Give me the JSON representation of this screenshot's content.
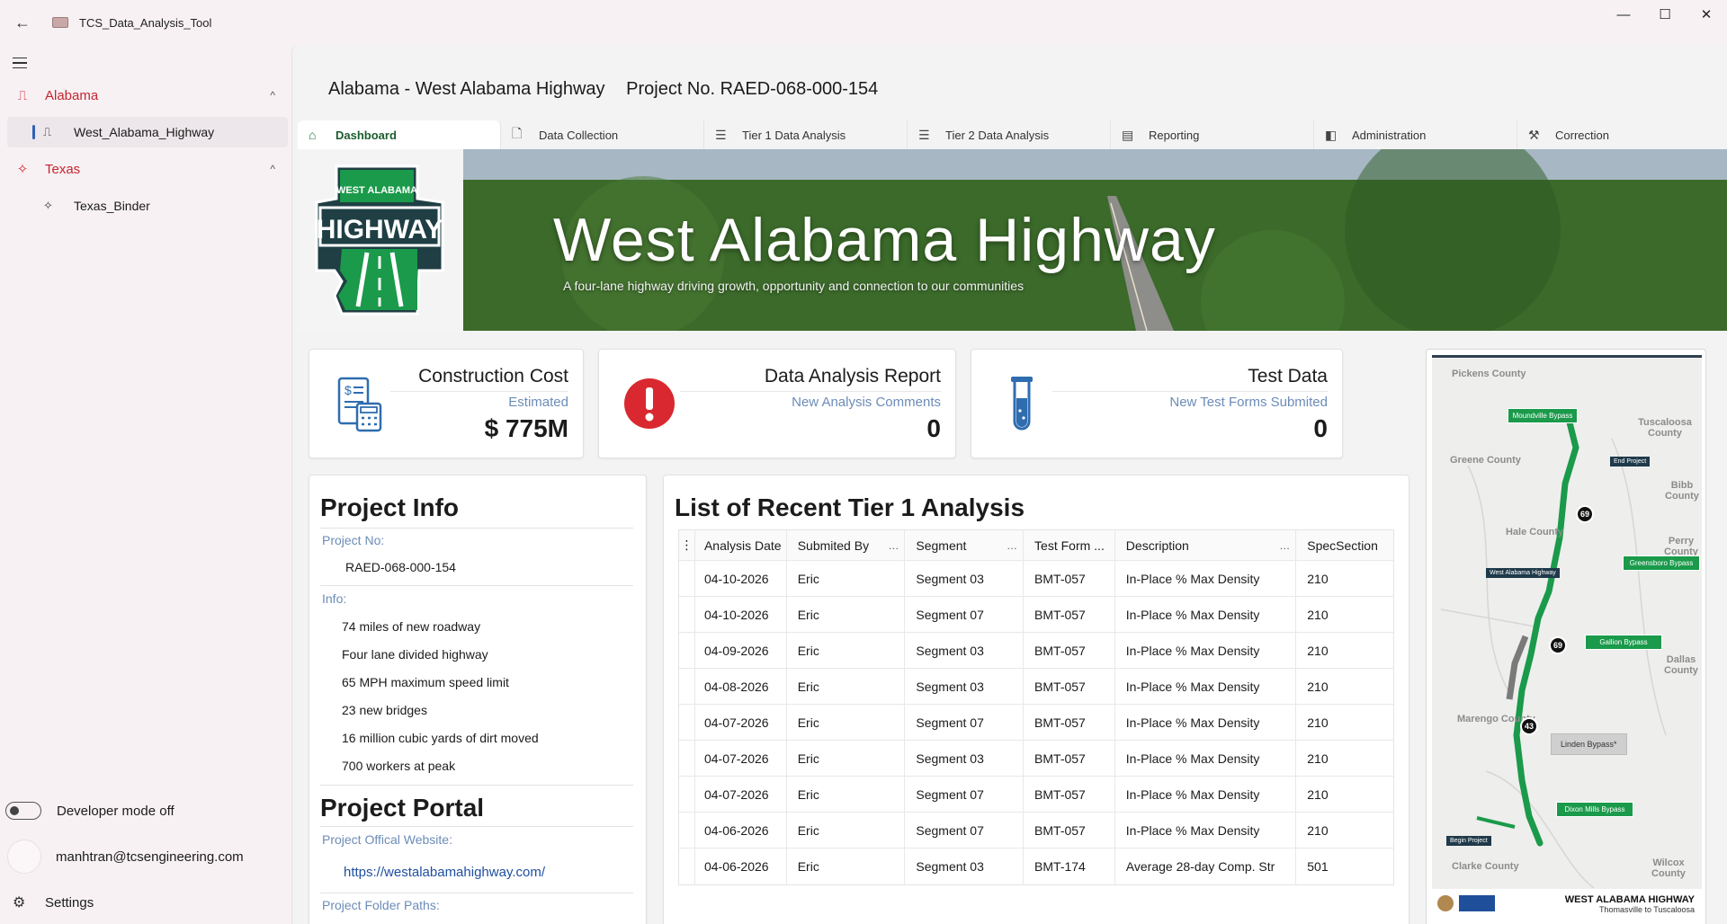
{
  "window": {
    "title": "TCS_Data_Analysis_Tool",
    "back_glyph": "←",
    "minimize_glyph": "—",
    "maximize_glyph": "☐",
    "close_glyph": "✕"
  },
  "sidebar": {
    "groups": [
      {
        "label": "Alabama",
        "chevron": "^",
        "items": [
          {
            "label": "West_Alabama_Highway",
            "selected": true
          }
        ]
      },
      {
        "label": "Texas",
        "chevron": "^",
        "items": [
          {
            "label": "Texas_Binder",
            "selected": false
          }
        ]
      }
    ],
    "developer_mode": "Developer mode off",
    "account": "manhtran@tcsengineering.com",
    "settings": "Settings"
  },
  "header": {
    "project_name": "Alabama - West Alabama Highway",
    "project_number": "Project No. RAED-068-000-154"
  },
  "tabs": [
    {
      "label": "Dashboard",
      "icon": "home-icon",
      "glyph": "⌂",
      "active": true
    },
    {
      "label": "Data Collection",
      "icon": "document-icon",
      "glyph": "🗋",
      "active": false
    },
    {
      "label": "Tier 1 Data Analysis",
      "icon": "checklist-icon",
      "glyph": "☰",
      "active": false
    },
    {
      "label": "Tier 2 Data Analysis",
      "icon": "checklist-icon",
      "glyph": "☰",
      "active": false
    },
    {
      "label": "Reporting",
      "icon": "report-icon",
      "glyph": "▤",
      "active": false
    },
    {
      "label": "Administration",
      "icon": "admin-icon",
      "glyph": "◧",
      "active": false
    },
    {
      "label": "Correction",
      "icon": "wrench-icon",
      "glyph": "⚒",
      "active": false
    }
  ],
  "banner": {
    "logo_top": "WEST ALABAMA",
    "logo_main": "HIGHWAY",
    "title": "West Alabama Highway",
    "subtitle": "A four-lane highway driving growth, opportunity and connection to our communities"
  },
  "stats": {
    "construction": {
      "title": "Construction Cost",
      "sub": "Estimated",
      "value": "$ 775M"
    },
    "report": {
      "title": "Data Analysis Report",
      "sub": "New Analysis Comments",
      "value": "0"
    },
    "test": {
      "title": "Test Data",
      "sub": "New Test Forms Submited",
      "value": "0"
    }
  },
  "project_info": {
    "title": "Project Info",
    "project_no_label": "Project No:",
    "project_no": "RAED-068-000-154",
    "info_label": "Info:",
    "info": [
      "74 miles of new roadway",
      "Four lane divided highway",
      "65 MPH maximum speed limit",
      "23 new bridges",
      "16 million cubic yards of dirt moved",
      "700 workers at peak"
    ],
    "portal_title": "Project Portal",
    "website_label": "Project Offical Website:",
    "website": "https://westalabamahighway.com/",
    "folder_label": "Project Folder Paths:"
  },
  "recent": {
    "title": "List of Recent Tier 1 Analysis",
    "columns": [
      "Analysis Date",
      "Submited By",
      "Segment",
      "Test Form ...",
      "Description",
      "SpecSection"
    ],
    "rows": [
      [
        "04-10-2026",
        "Eric",
        "Segment 03",
        "BMT-057",
        "In-Place % Max Density",
        "210"
      ],
      [
        "04-10-2026",
        "Eric",
        "Segment 07",
        "BMT-057",
        "In-Place % Max Density",
        "210"
      ],
      [
        "04-09-2026",
        "Eric",
        "Segment 03",
        "BMT-057",
        "In-Place % Max Density",
        "210"
      ],
      [
        "04-08-2026",
        "Eric",
        "Segment 03",
        "BMT-057",
        "In-Place % Max Density",
        "210"
      ],
      [
        "04-07-2026",
        "Eric",
        "Segment 07",
        "BMT-057",
        "In-Place % Max Density",
        "210"
      ],
      [
        "04-07-2026",
        "Eric",
        "Segment 03",
        "BMT-057",
        "In-Place % Max Density",
        "210"
      ],
      [
        "04-07-2026",
        "Eric",
        "Segment 07",
        "BMT-057",
        "In-Place % Max Density",
        "210"
      ],
      [
        "04-06-2026",
        "Eric",
        "Segment 07",
        "BMT-057",
        "In-Place % Max Density",
        "210"
      ],
      [
        "04-06-2026",
        "Eric",
        "Segment 03",
        "BMT-174",
        "Average 28-day Comp. Str",
        "501"
      ]
    ]
  },
  "map": {
    "counties": [
      "Pickens County",
      "Tuscaloosa County",
      "Greene County",
      "Bibb County",
      "Hale County",
      "Perry County",
      "Dallas County",
      "Marengo County",
      "Clarke County",
      "Wilcox County"
    ],
    "bypasses": [
      "Moundville Bypass",
      "Greensboro Bypass",
      "Gallion Bypass",
      "Dixon Mills Bypass"
    ],
    "tags": {
      "end": "End Project",
      "begin": "Begin Project",
      "highway": "West Alabama Highway",
      "linden": "Linden Bypass*"
    },
    "shields": [
      "69",
      "69",
      "43"
    ],
    "footer_title": "WEST ALABAMA HIGHWAY",
    "footer_sub": "Thomasville to Tuscaloosa"
  },
  "colors": {
    "accent_red": "#c4262e",
    "accent_green": "#1a9a4a",
    "link_blue": "#1f4fa0",
    "label_blue": "#6c8cb8"
  }
}
